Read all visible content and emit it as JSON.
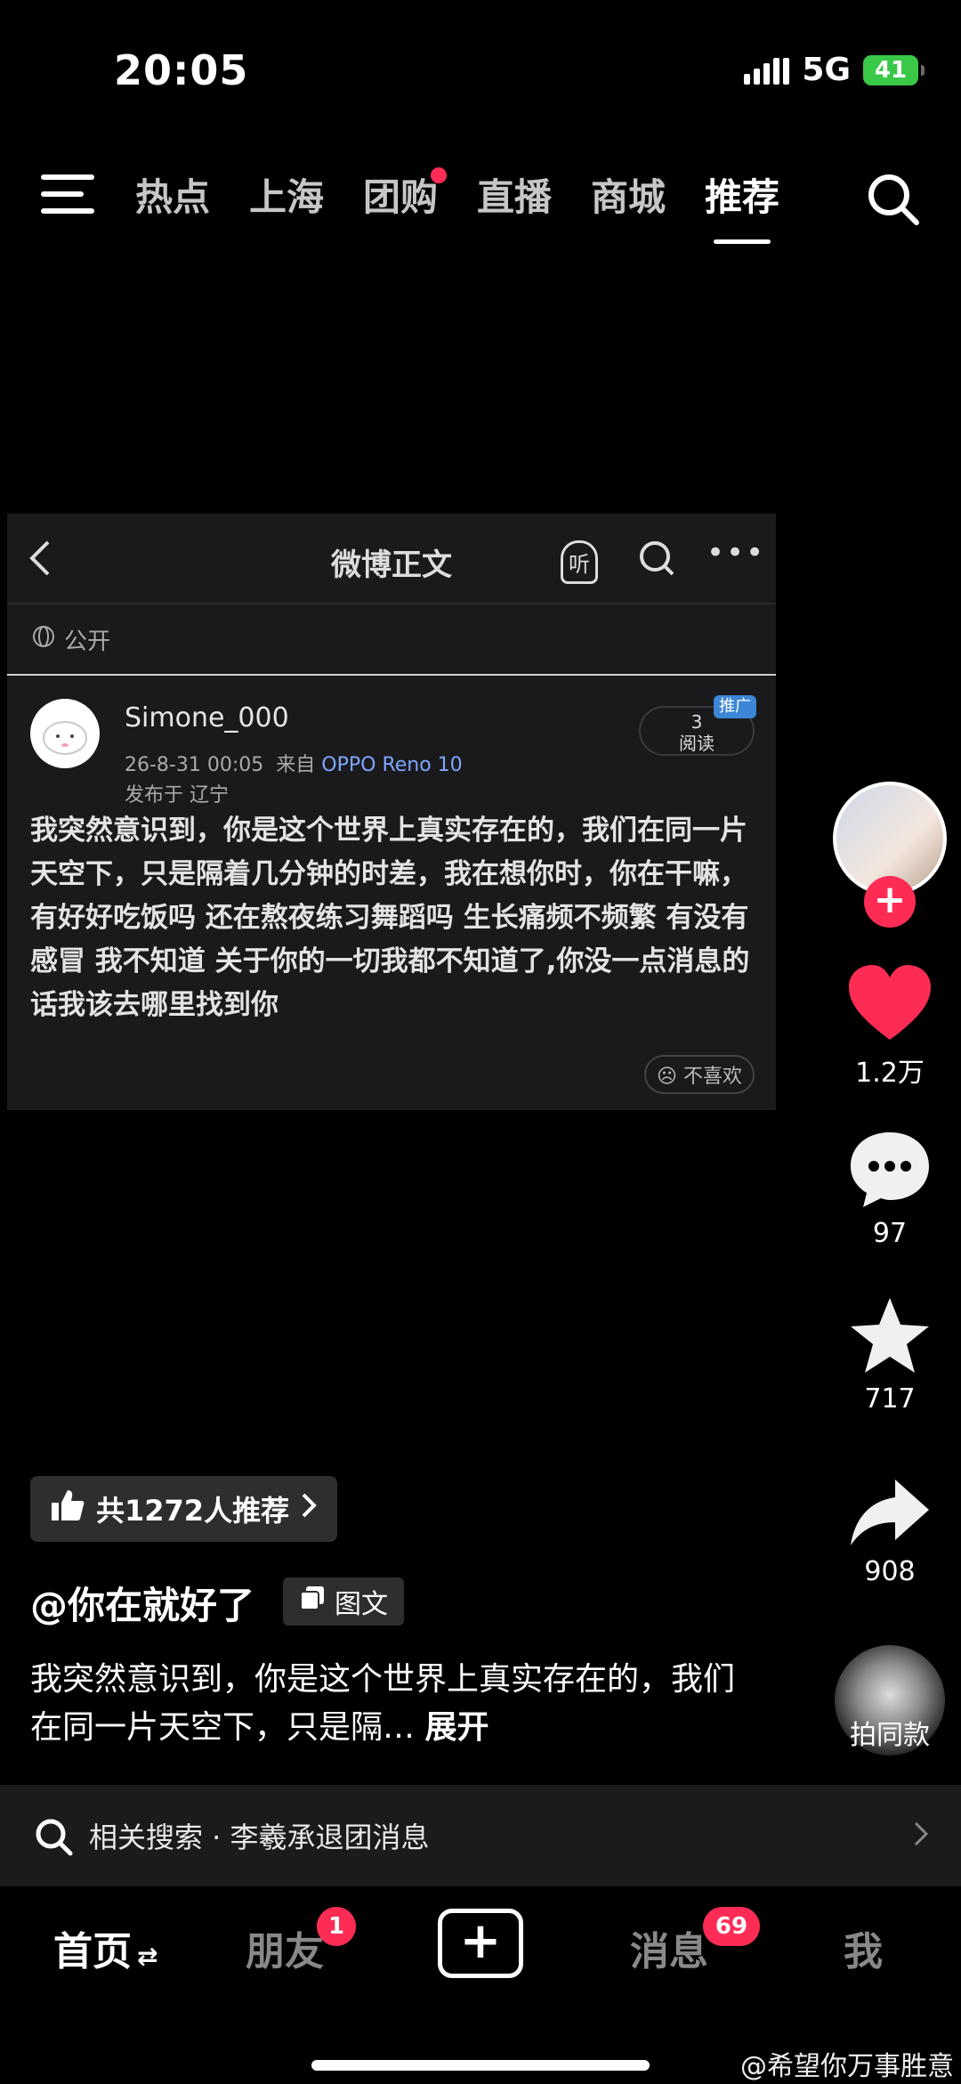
{
  "status": {
    "time": "20:05",
    "network": "5G",
    "battery": "41"
  },
  "top_nav": {
    "tabs": [
      {
        "label": "热点"
      },
      {
        "label": "上海"
      },
      {
        "label": "团购"
      },
      {
        "label": "直播"
      },
      {
        "label": "商城"
      },
      {
        "label": "推荐"
      }
    ],
    "active_tab": "推荐"
  },
  "weibo_card": {
    "title": "微博正文",
    "listen_label": "听",
    "visibility": "公开",
    "username": "Simone_000",
    "date": "26-8-31 00:05",
    "source_prefix": "来自",
    "source_device": "OPPO Reno 10",
    "location": "发布于 辽宁",
    "reads_count": "3",
    "reads_label": "阅读",
    "ad_badge": "推广",
    "body": "我突然意识到，你是这个世界上真实存在的，我们在同一片天空下，只是隔着几分钟的时差，我在想你时，你在干嘛，有好好吃饭吗 还在熬夜练习舞蹈吗 生长痛频不频繁 有没有感冒 我不知道 关于你的一切我都不知道了,你没一点消息的话我该去哪里找到你",
    "dislike_label": "不喜欢"
  },
  "actions": {
    "likes": "1.2万",
    "comments": "97",
    "favorites": "717",
    "shares": "908",
    "same_label": "拍同款"
  },
  "recommend_pill": {
    "label": "共1272人推荐"
  },
  "author": "@你在就好了",
  "type_tag": "图文",
  "description": "我突然意识到，你是这个世界上真实存在的，我们在同一片天空下，只是隔…",
  "expand_label": "展开",
  "related_search": {
    "label": "相关搜索 · 李羲承退团消息"
  },
  "bottom_nav": {
    "home": "首页",
    "friends": "朋友",
    "friends_badge": "1",
    "messages": "消息",
    "messages_badge": "69",
    "me": "我"
  },
  "watermark": "@希望你万事胜意",
  "colors": {
    "accent": "#fe2c55",
    "battery": "#39c847",
    "link": "#7da6ff"
  }
}
